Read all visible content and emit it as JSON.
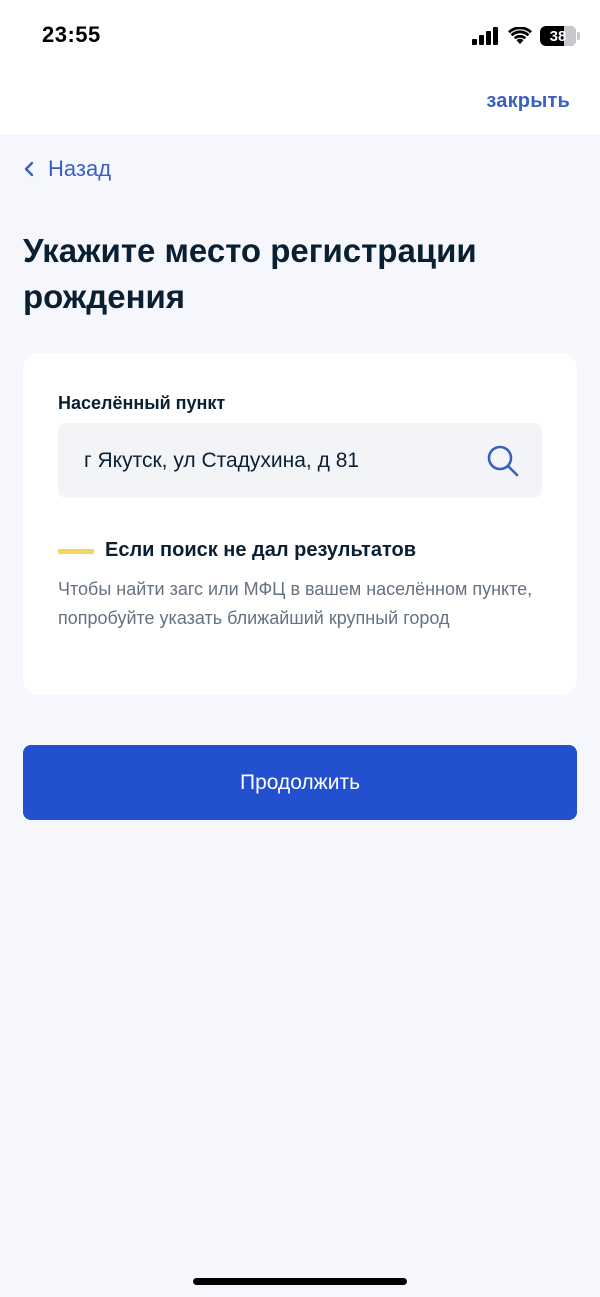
{
  "status_bar": {
    "time": "23:55",
    "battery_percent": "38",
    "icons": [
      "signal-icon",
      "wifi-icon",
      "battery-icon"
    ]
  },
  "top_bar": {
    "close_label": "закрыть"
  },
  "nav": {
    "back_label": "Назад",
    "back_icon": "chevron-left-icon"
  },
  "page": {
    "title": "Укажите место регистрации рождения"
  },
  "form": {
    "locality_label": "Населённый пункт",
    "locality_value": "г Якутск, ул Стадухина, д 81",
    "search_icon": "search-icon"
  },
  "hint": {
    "title": "Если поиск не дал результатов",
    "text": "Чтобы найти загс или МФЦ в вашем населённом пункте, попробуйте указать ближайший крупный город"
  },
  "actions": {
    "continue_label": "Продолжить"
  },
  "colors": {
    "accent": "#3b5fc2",
    "primary_button": "#2350cf",
    "hint_marker": "#f4d35e",
    "background": "#f5f7fc"
  }
}
